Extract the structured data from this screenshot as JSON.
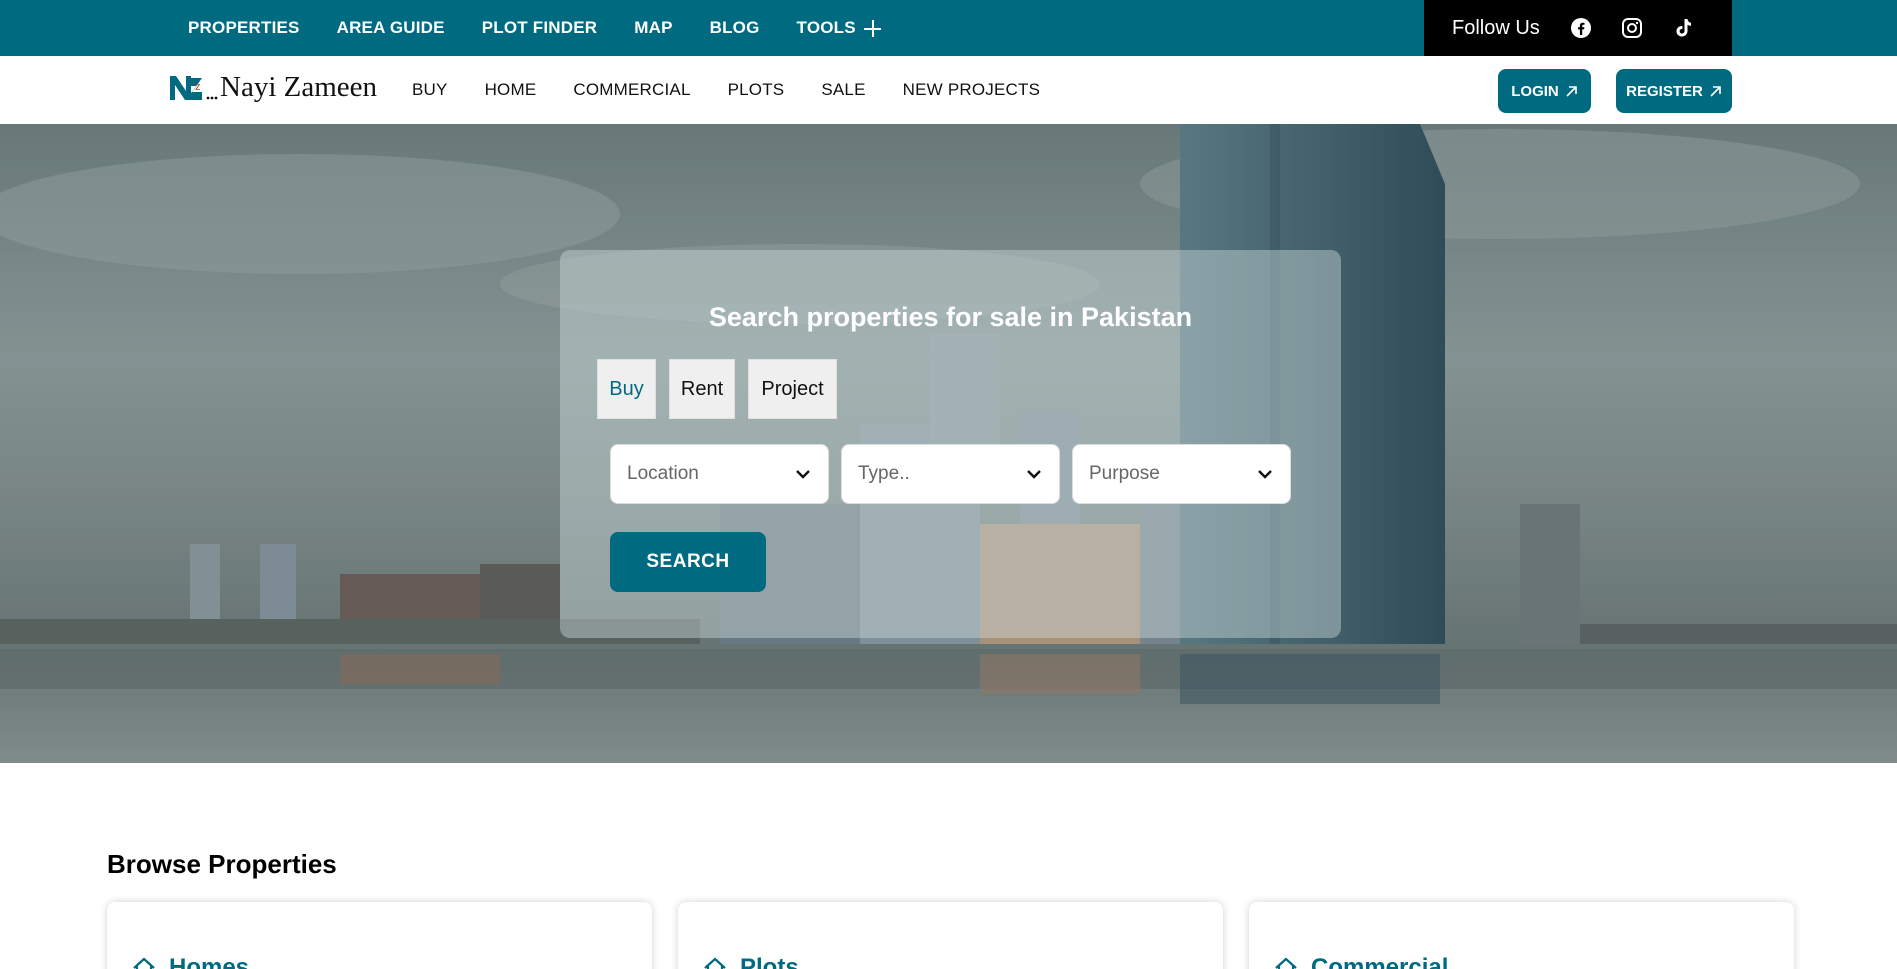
{
  "topbar": {
    "links": [
      "PROPERTIES",
      "AREA GUIDE",
      "PLOT FINDER",
      "MAP",
      "BLOG",
      "TOOLS"
    ],
    "follow_label": "Follow Us",
    "social_icons": [
      "facebook-icon",
      "instagram-icon",
      "tiktok-icon"
    ],
    "color": "#006a80"
  },
  "header": {
    "logo_text": "Nayi Zameen",
    "nav": [
      "BUY",
      "HOME",
      "COMMERCIAL",
      "PLOTS",
      "SALE",
      "NEW PROJECTS"
    ],
    "login_label": "LOGIN",
    "register_label": "REGISTER"
  },
  "hero": {
    "title": "Search properties for sale in Pakistan",
    "tabs": [
      "Buy",
      "Rent",
      "Project"
    ],
    "active_tab": "Buy",
    "location_placeholder": "Location",
    "type_placeholder": "Type..",
    "purpose_placeholder": "Purpose",
    "search_label": "SEARCH"
  },
  "browse": {
    "title": "Browse Properties",
    "cards": [
      "Homes",
      "Plots",
      "Commercial"
    ]
  }
}
